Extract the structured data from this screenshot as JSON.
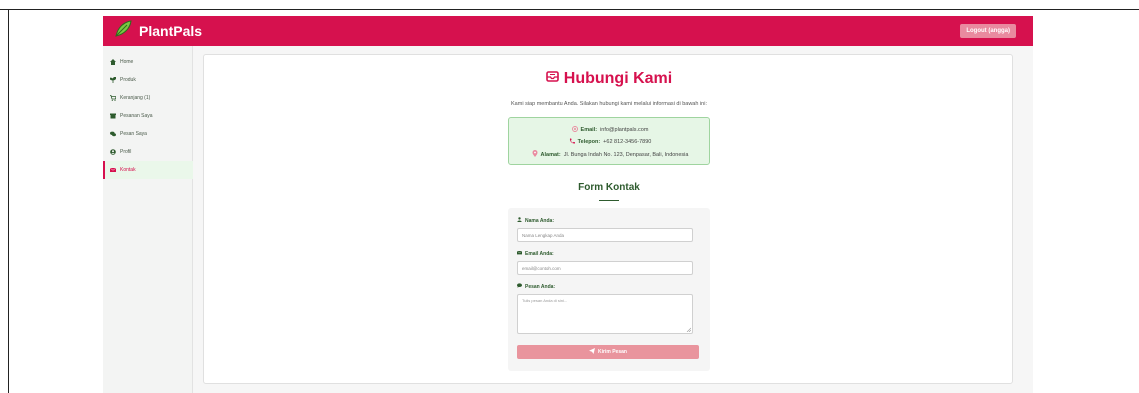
{
  "app": {
    "title": "PlantPals",
    "logout_label": "Logout (angga)"
  },
  "colors": {
    "brand": "#d6114e",
    "green": "#2e5b2e",
    "accent_light": "#e6f6e6"
  },
  "sidebar": {
    "items": [
      {
        "label": "Home",
        "icon": "home-icon",
        "active": false
      },
      {
        "label": "Produk",
        "icon": "seedling-icon",
        "active": false
      },
      {
        "label": "Keranjang (1)",
        "icon": "cart-icon",
        "active": false
      },
      {
        "label": "Pesanan Saya",
        "icon": "box-icon",
        "active": false
      },
      {
        "label": "Pesan Saya",
        "icon": "comments-icon",
        "active": false
      },
      {
        "label": "Profil",
        "icon": "user-circle-icon",
        "active": false
      },
      {
        "label": "Kontak",
        "icon": "envelope-icon",
        "active": true
      }
    ]
  },
  "main": {
    "title": "Hubungi Kami",
    "intro": "Kami siap membantu Anda. Silakan hubungi kami melalui informasi di bawah ini:",
    "contact": {
      "email_label": "Email:",
      "email_value": "info@plantpals.com",
      "phone_label": "Telepon:",
      "phone_value": "+62 812-3456-7890",
      "address_label": "Alamat:",
      "address_value": "Jl. Bunga Indah No. 123, Denpasar, Bali, Indonesia"
    },
    "form": {
      "heading": "Form Kontak",
      "name_label": "Nama Anda:",
      "name_placeholder": "Nama Lengkap Anda",
      "email_label": "Email Anda:",
      "email_placeholder": "email@contoh.com",
      "message_label": "Pesan Anda:",
      "message_placeholder": "Tulis pesan Anda di sini...",
      "submit_label": "Kirim Pesan"
    }
  }
}
